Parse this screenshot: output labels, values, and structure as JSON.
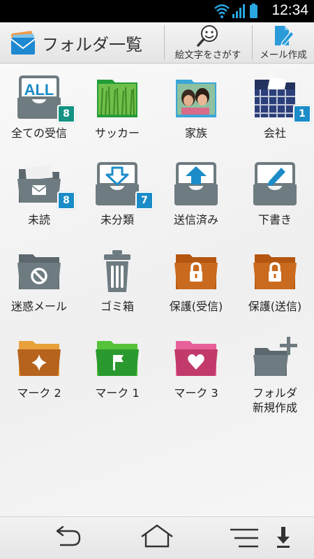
{
  "status_bar": {
    "time": "12:34"
  },
  "header": {
    "title": "フォルダ一覧",
    "emoji_search_label": "絵文字をさがす",
    "compose_label": "メール作成"
  },
  "colors": {
    "teal_badge": "#149383",
    "blue_badge": "#1b8cc8",
    "gray_folder": "#6e7b80",
    "orange_folder": "#c96a1f",
    "brown_folder": "#b6631e",
    "green_folder": "#2a9a2e",
    "pink_folder": "#c23a6c"
  },
  "folders": [
    {
      "label": "全ての受信",
      "badge": "8",
      "icon": "all-inbox-icon"
    },
    {
      "label": "サッカー",
      "badge": "",
      "icon": "grass-photo-folder-icon"
    },
    {
      "label": "家族",
      "badge": "",
      "icon": "family-photo-folder-icon"
    },
    {
      "label": "会社",
      "badge": "1",
      "icon": "plaid-folder-icon"
    },
    {
      "label": "未読",
      "badge": "8",
      "icon": "unread-folder-icon"
    },
    {
      "label": "未分類",
      "badge": "7",
      "icon": "unsorted-tray-icon"
    },
    {
      "label": "送信済み",
      "badge": "",
      "icon": "sent-tray-icon"
    },
    {
      "label": "下書き",
      "badge": "",
      "icon": "draft-tray-icon"
    },
    {
      "label": "迷惑メール",
      "badge": "",
      "icon": "spam-folder-icon"
    },
    {
      "label": "ゴミ箱",
      "badge": "",
      "icon": "trash-can-icon"
    },
    {
      "label": "保護(受信)",
      "badge": "",
      "icon": "locked-folder-icon"
    },
    {
      "label": "保護(送信)",
      "badge": "",
      "icon": "locked-folder-icon"
    },
    {
      "label": "マーク 2",
      "badge": "",
      "icon": "star-folder-icon"
    },
    {
      "label": "マーク 1",
      "badge": "",
      "icon": "flag-folder-icon"
    },
    {
      "label": "マーク 3",
      "badge": "",
      "icon": "heart-folder-icon"
    },
    {
      "label": "フォルダ",
      "label2": "新規作成",
      "badge": "",
      "icon": "new-folder-icon"
    }
  ]
}
